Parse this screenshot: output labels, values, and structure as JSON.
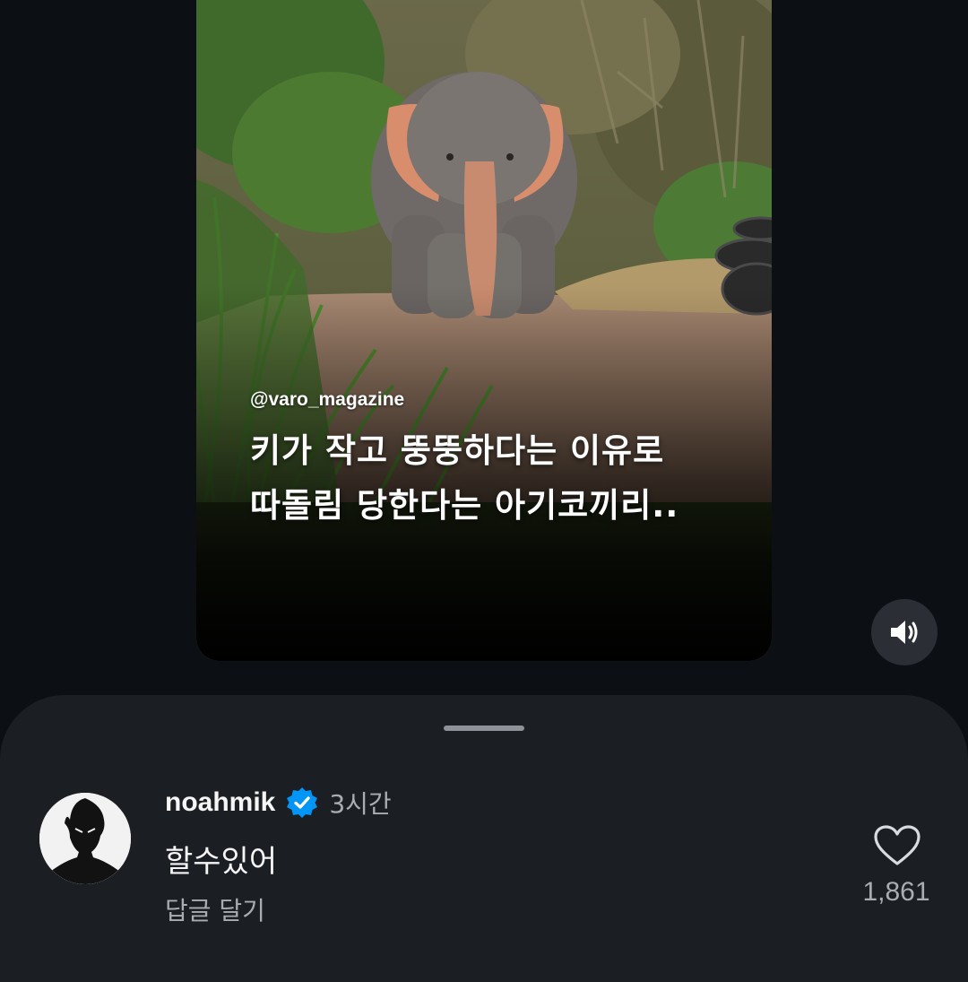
{
  "video": {
    "source_handle": "@varo_magazine",
    "headline_lines": [
      "키가 작고 뚱뚱하다는 이유로",
      "따돌림 당한다는 아기코끼리.."
    ]
  },
  "controls": {
    "sound_icon": "speaker-volume-icon"
  },
  "comment": {
    "username": "noahmik",
    "verified_icon": "verified-badge-icon",
    "timestamp": "3시간",
    "text": "할수있어",
    "reply_label": "답글 달기",
    "like_icon": "heart-outline-icon",
    "like_count": "1,861"
  },
  "colors": {
    "background": "#0c1014",
    "sheet": "#1b1f24",
    "verified_blue": "#0095f6",
    "secondary_text": "#a8adb3"
  }
}
